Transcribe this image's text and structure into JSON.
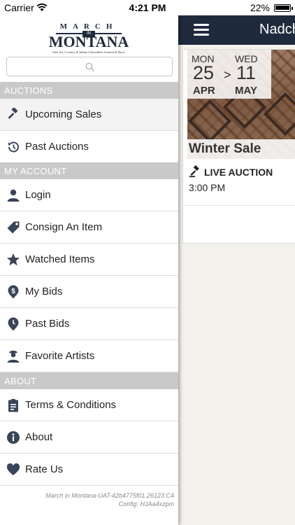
{
  "status_bar": {
    "carrier": "Carrier",
    "time": "4:21 PM",
    "battery": "22%"
  },
  "topbar": {
    "title": "Nadch"
  },
  "sale_card": {
    "start": {
      "dow": "MON",
      "day": "25",
      "month": "APR"
    },
    "end": {
      "dow": "WED",
      "day": "11",
      "month": "MAY"
    },
    "arrow": ">",
    "title": "Winter Sale",
    "auction_type": "LIVE AUCTION",
    "time": "3:00 PM"
  },
  "drawer": {
    "logo": {
      "march": "MARCH",
      "in": "IN",
      "montana": "MONTANA",
      "tagline": "Fine Art, Cowboy & Indian Collectibles Auction & Show"
    },
    "search": {
      "placeholder": ""
    },
    "sections": {
      "auctions": "AUCTIONS",
      "my_account": "MY ACCOUNT",
      "about": "ABOUT"
    },
    "items": {
      "upcoming_sales": "Upcoming Sales",
      "past_auctions": "Past Auctions",
      "login": "Login",
      "consign": "Consign An Item",
      "watched": "Watched Items",
      "my_bids": "My Bids",
      "past_bids": "Past Bids",
      "favorite_artists": "Favorite Artists",
      "terms": "Terms & Conditions",
      "about": "About",
      "rate_us": "Rate Us"
    },
    "config": {
      "line1": "March in Montana-UAT-42b4775f01.26123:C4",
      "line2": "Config: HJAa4xzpm"
    }
  },
  "colors": {
    "navbar": "#1f2a3d",
    "section_header": "#c9c9c9",
    "icon": "#3a4559"
  }
}
